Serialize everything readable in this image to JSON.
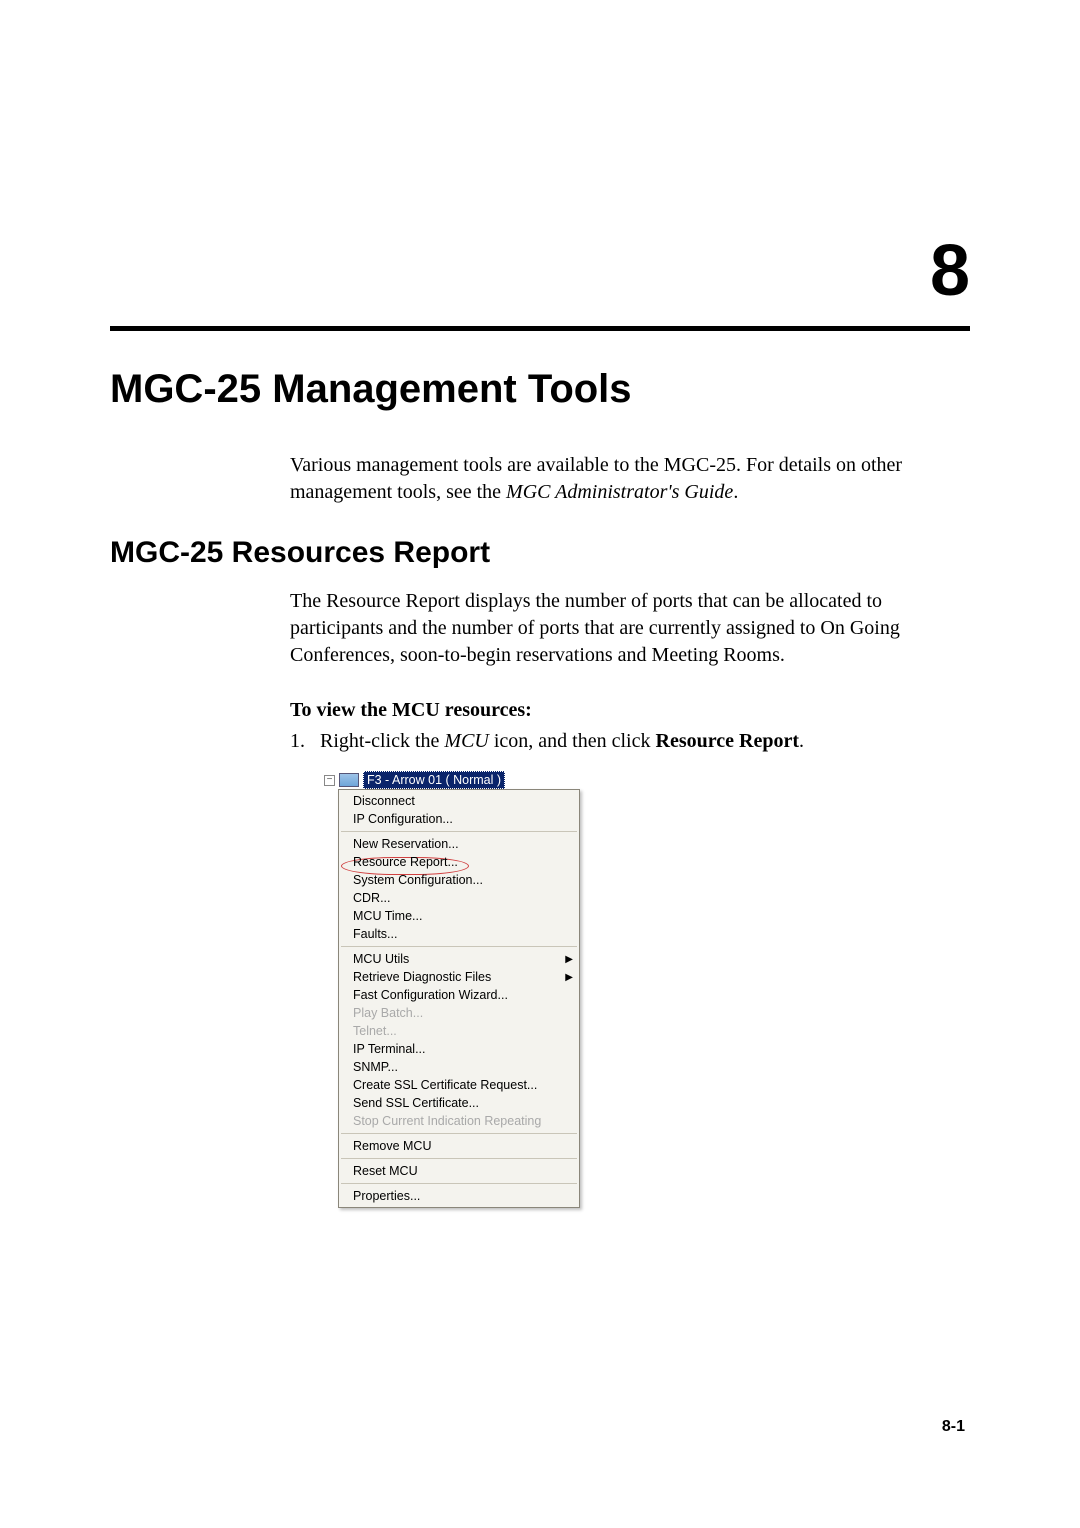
{
  "chapter": {
    "number": "8",
    "title": "MGC-25 Management Tools"
  },
  "intro": {
    "line1": "Various management tools are available to the MGC-25. For details on other management tools, see the ",
    "em": "MGC Administrator's Guide",
    "after": "."
  },
  "section": {
    "heading": "MGC-25 Resources Report",
    "para": "The Resource Report displays the number of ports that can be allocated to participants and the number of ports that are currently assigned to On Going Conferences, soon-to-begin reservations and Meeting Rooms.",
    "sub_bold": "To view the MCU resources:",
    "step_num": "1.",
    "step_pre": "Right-click the ",
    "step_em": "MCU",
    "step_mid": " icon, and then click ",
    "step_bold": "Resource Report",
    "step_after": "."
  },
  "tree": {
    "node_label": "F3 - Arrow 01    ( Normal )"
  },
  "menu": {
    "items": [
      {
        "label": "Disconnect",
        "enabled": true
      },
      {
        "label": "IP Configuration...",
        "enabled": true
      },
      {
        "sep": true
      },
      {
        "label": "New Reservation...",
        "enabled": true
      },
      {
        "label": "Resource Report...",
        "enabled": true,
        "highlighted": true
      },
      {
        "label": "System Configuration...",
        "enabled": true
      },
      {
        "label": "CDR...",
        "enabled": true
      },
      {
        "label": "MCU Time...",
        "enabled": true
      },
      {
        "label": "Faults...",
        "enabled": true
      },
      {
        "sep": true
      },
      {
        "label": "MCU Utils",
        "enabled": true,
        "submenu": true
      },
      {
        "label": "Retrieve Diagnostic Files",
        "enabled": true,
        "submenu": true
      },
      {
        "label": "Fast Configuration Wizard...",
        "enabled": true
      },
      {
        "label": "Play Batch...",
        "enabled": false
      },
      {
        "label": "Telnet...",
        "enabled": false
      },
      {
        "label": "IP Terminal...",
        "enabled": true
      },
      {
        "label": "SNMP...",
        "enabled": true
      },
      {
        "label": "Create SSL Certificate Request...",
        "enabled": true
      },
      {
        "label": "Send SSL Certificate...",
        "enabled": true
      },
      {
        "label": "Stop Current Indication Repeating",
        "enabled": false
      },
      {
        "sep": true
      },
      {
        "label": "Remove MCU",
        "enabled": true
      },
      {
        "sep": true
      },
      {
        "label": "Reset MCU",
        "enabled": true
      },
      {
        "sep": true
      },
      {
        "label": "Properties...",
        "enabled": true
      }
    ]
  },
  "page_number": "8-1"
}
